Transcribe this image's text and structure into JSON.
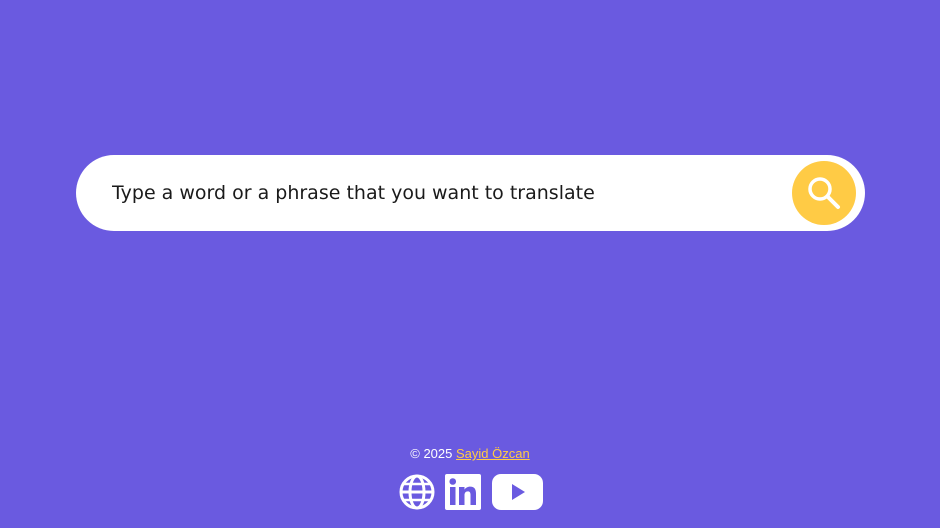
{
  "search": {
    "placeholder": "Type a word or a phrase that you want to translate",
    "button_icon": "search-icon"
  },
  "footer": {
    "copyright_prefix": "© 2025",
    "author": "Sayid Özcan",
    "social": [
      {
        "icon": "globe-icon",
        "name": "website"
      },
      {
        "icon": "linkedin-icon",
        "name": "linkedin"
      },
      {
        "icon": "youtube-icon",
        "name": "youtube"
      }
    ]
  },
  "colors": {
    "background": "#6a5ae0",
    "accent": "#ffcb45",
    "surface": "#ffffff"
  }
}
